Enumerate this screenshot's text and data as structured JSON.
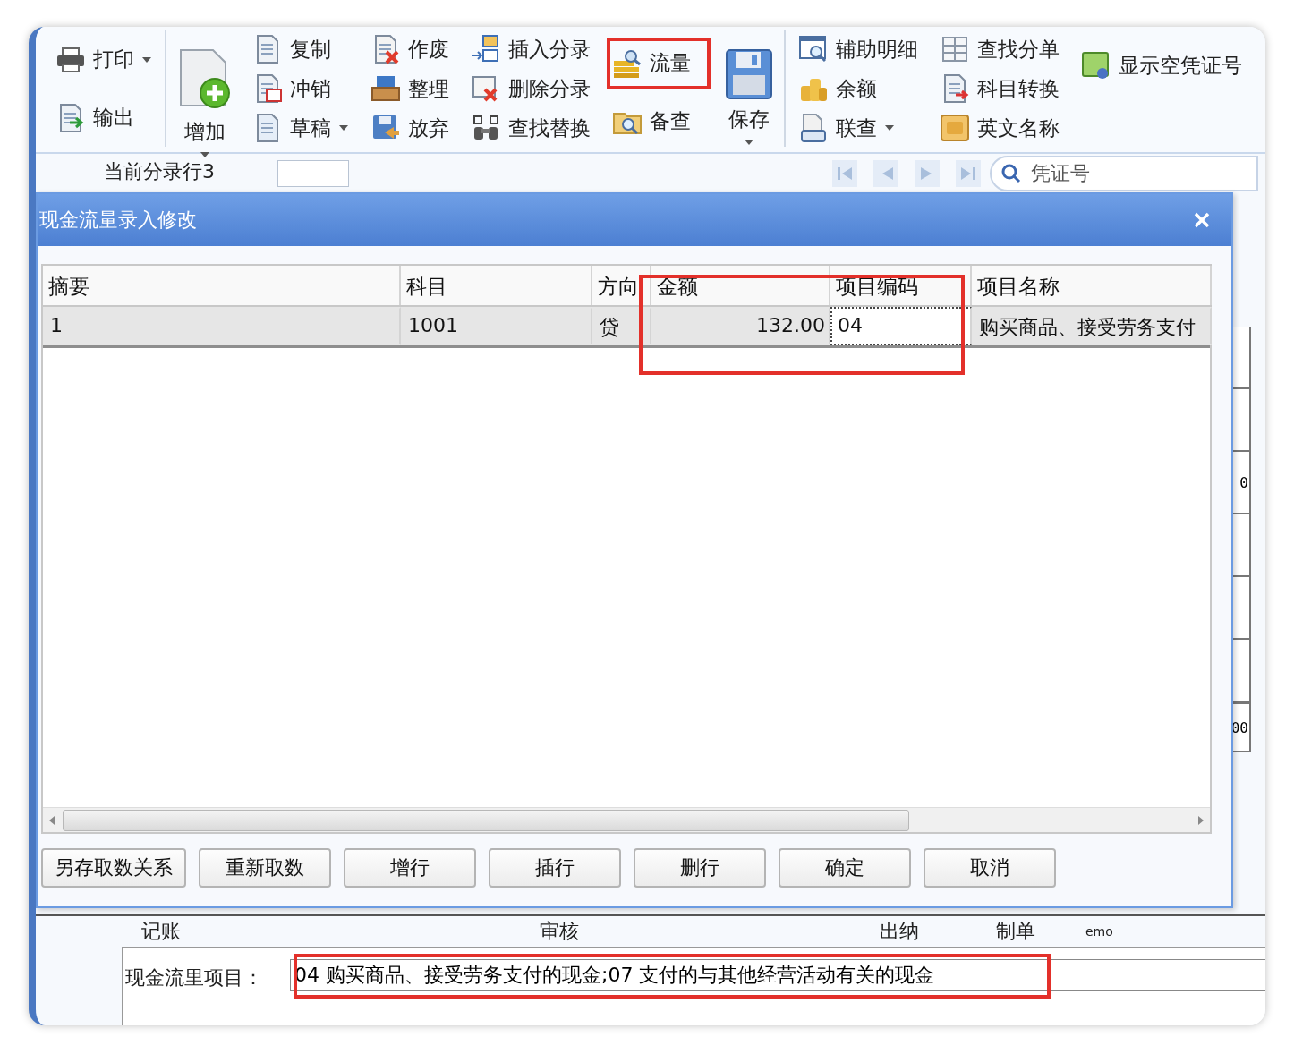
{
  "toolbar": {
    "groups": [
      {
        "columns": [
          {
            "kind": "small",
            "items": [
              {
                "label": "打印",
                "dropdown": true,
                "highlighted": false
              },
              {
                "label": "输出",
                "dropdown": false,
                "highlighted": false
              }
            ]
          }
        ]
      },
      {
        "columns": [
          {
            "kind": "large",
            "items": [
              {
                "label": "增加",
                "dropdown": true,
                "highlighted": false
              }
            ]
          },
          {
            "kind": "small",
            "items": [
              {
                "label": "复制",
                "dropdown": false,
                "highlighted": false
              },
              {
                "label": "冲销",
                "dropdown": false,
                "highlighted": false
              },
              {
                "label": "草稿",
                "dropdown": true,
                "highlighted": false
              }
            ]
          },
          {
            "kind": "small",
            "items": [
              {
                "label": "作废",
                "dropdown": false,
                "highlighted": false
              },
              {
                "label": "整理",
                "dropdown": false,
                "highlighted": false
              },
              {
                "label": "放弃",
                "dropdown": false,
                "highlighted": false
              }
            ]
          },
          {
            "kind": "small",
            "items": [
              {
                "label": "插入分录",
                "dropdown": false,
                "highlighted": false
              },
              {
                "label": "删除分录",
                "dropdown": false,
                "highlighted": false
              },
              {
                "label": "查找替换",
                "dropdown": false,
                "highlighted": false
              }
            ]
          },
          {
            "kind": "small",
            "items": [
              {
                "label": "流量",
                "dropdown": false,
                "highlighted": true
              },
              {
                "label": "备查",
                "dropdown": false,
                "highlighted": false
              }
            ]
          },
          {
            "kind": "large",
            "items": [
              {
                "label": "保存",
                "dropdown": true,
                "highlighted": false
              }
            ]
          }
        ]
      },
      {
        "columns": [
          {
            "kind": "small",
            "items": [
              {
                "label": "辅助明细",
                "dropdown": false,
                "highlighted": false
              },
              {
                "label": "余额",
                "dropdown": false,
                "highlighted": false
              },
              {
                "label": "联查",
                "dropdown": true,
                "highlighted": false
              }
            ]
          },
          {
            "kind": "small",
            "items": [
              {
                "label": "查找分单",
                "dropdown": false,
                "highlighted": false
              },
              {
                "label": "科目转换",
                "dropdown": false,
                "highlighted": false
              },
              {
                "label": "英文名称",
                "dropdown": false,
                "highlighted": false
              }
            ]
          },
          {
            "kind": "small",
            "items": [
              {
                "label": "显示空凭证号",
                "dropdown": false,
                "highlighted": false
              }
            ]
          }
        ]
      }
    ]
  },
  "entry_bar": {
    "label": "当前分录行3",
    "search": {
      "placeholder": "凭证号"
    }
  },
  "dialog": {
    "title": "现金流量录入修改",
    "table": {
      "columns": [
        {
          "label": "摘要",
          "kind": "text",
          "highlighted": false
        },
        {
          "label": "科目",
          "kind": "text",
          "highlighted": false
        },
        {
          "label": "方向",
          "kind": "text",
          "highlighted": false
        },
        {
          "label": "金额",
          "kind": "amount",
          "highlighted": true
        },
        {
          "label": "项目编码",
          "kind": "text",
          "highlighted": true
        },
        {
          "label": "项目名称",
          "kind": "text",
          "highlighted": false
        }
      ],
      "rows": [
        {
          "selected": true,
          "cells": [
            {
              "text": "1",
              "focused": false
            },
            {
              "text": "1001",
              "focused": false
            },
            {
              "text": "贷",
              "focused": false
            },
            {
              "text": "132.00",
              "focused": false
            },
            {
              "text": "04",
              "focused": true
            },
            {
              "text": "购买商品、接受劳务支付",
              "focused": false
            }
          ]
        }
      ]
    },
    "buttons": [
      "另存取数关系",
      "重新取数",
      "增行",
      "插行",
      "删行",
      "确定",
      "取消"
    ]
  },
  "background": {
    "grid_texts": [
      "0",
      "00"
    ],
    "signatures": [
      "记账",
      "审核",
      "出纳",
      "制单",
      "emo"
    ],
    "cash_flow": {
      "label": "现金流里项目：",
      "value": "04 购买商品、接受劳务支付的现金;07 支付的与其他经营活动有关的现金",
      "highlighted": true
    }
  }
}
